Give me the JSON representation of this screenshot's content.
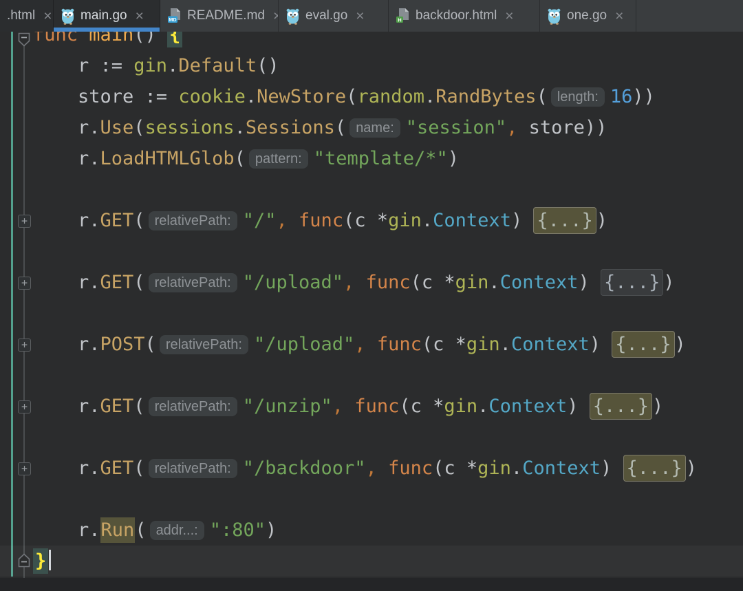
{
  "tab_bar": {
    "close_glyph": "×",
    "tabs": [
      {
        "label": ".html",
        "icon": null,
        "shade": "dark",
        "active": false
      },
      {
        "label": "main.go",
        "icon": "go-gopher-icon",
        "shade": "dark",
        "active": true
      },
      {
        "label": "README.md",
        "icon": "markdown-file-icon",
        "shade": "light",
        "active": false
      },
      {
        "label": "eval.go",
        "icon": "go-gopher-icon",
        "shade": "light",
        "active": false
      },
      {
        "label": "backdoor.html",
        "icon": "html-file-icon",
        "shade": "light",
        "active": false
      },
      {
        "label": "one.go",
        "icon": "go-gopher-icon",
        "shade": "light",
        "active": false
      }
    ]
  },
  "colors": {
    "editor_background": "#2B2C2D",
    "tab_bar_background": "#3A3D3F",
    "active_tab_underline": "#4385C9",
    "keyword": "#D4854A",
    "function_call": "#C8A465",
    "package_name": "#AFB556",
    "string": "#73A65B",
    "number": "#549FDA",
    "type_name": "#54A8C7",
    "matched_brace_text": "#FDEB3A",
    "matched_brace_background": "#3B514D",
    "fold_highlight_background": "#56543A",
    "vcs_change_stripe": "#53A08D",
    "go_file_icon_blue": "#7EC9E3",
    "markdown_badge_blue": "#369FD4",
    "html_badge_green": "#4F9C49"
  },
  "editor": {
    "language": "Go",
    "lines": [
      {
        "g": "fold-top",
        "ind": 0,
        "tk": [
          [
            "kw",
            "func "
          ],
          [
            "fndecl",
            "main"
          ],
          [
            "p",
            "() "
          ],
          [
            "brace",
            "{"
          ]
        ]
      },
      {
        "ind": 1,
        "tk": [
          [
            "p",
            "r := "
          ],
          [
            "pkg",
            "gin"
          ],
          [
            "p",
            "."
          ],
          [
            "fn",
            "Default"
          ],
          [
            "p",
            "()"
          ]
        ]
      },
      {
        "ind": 1,
        "tk": [
          [
            "p",
            "store := "
          ],
          [
            "pkg",
            "cookie"
          ],
          [
            "p",
            "."
          ],
          [
            "fn",
            "NewStore"
          ],
          [
            "p",
            "("
          ],
          [
            "pkg",
            "random"
          ],
          [
            "p",
            "."
          ],
          [
            "fn",
            "RandBytes"
          ],
          [
            "p",
            "("
          ],
          [
            "hint",
            "length:"
          ],
          [
            "num",
            "16"
          ],
          [
            "p",
            "))"
          ]
        ]
      },
      {
        "ind": 1,
        "tk": [
          [
            "p",
            "r."
          ],
          [
            "fn",
            "Use"
          ],
          [
            "p",
            "("
          ],
          [
            "pkg",
            "sessions"
          ],
          [
            "p",
            "."
          ],
          [
            "fn",
            "Sessions"
          ],
          [
            "p",
            "("
          ],
          [
            "hint",
            "name:"
          ],
          [
            "str",
            "\"session\""
          ],
          [
            "comma",
            ","
          ],
          [
            "p",
            " store))"
          ]
        ]
      },
      {
        "ind": 1,
        "tk": [
          [
            "p",
            "r."
          ],
          [
            "fn",
            "LoadHTMLGlob"
          ],
          [
            "p",
            "("
          ],
          [
            "hint",
            "pattern:"
          ],
          [
            "str",
            "\"template/*\""
          ],
          [
            "p",
            ")"
          ]
        ]
      },
      {
        "tk": []
      },
      {
        "g": "plus",
        "ind": 1,
        "tk": [
          [
            "p",
            "r."
          ],
          [
            "fn",
            "GET"
          ],
          [
            "p",
            "("
          ],
          [
            "hint",
            "relativePath:"
          ],
          [
            "str",
            "\"/\""
          ],
          [
            "comma",
            ","
          ],
          [
            "p",
            " "
          ],
          [
            "kw",
            "func"
          ],
          [
            "p",
            "(c *"
          ],
          [
            "pkg",
            "gin"
          ],
          [
            "p",
            "."
          ],
          [
            "typ",
            "Context"
          ],
          [
            "p",
            ") "
          ],
          [
            "foldhl",
            "{...}"
          ],
          [
            "p",
            ")"
          ]
        ]
      },
      {
        "tk": []
      },
      {
        "g": "plus",
        "ind": 1,
        "tk": [
          [
            "p",
            "r."
          ],
          [
            "fn",
            "GET"
          ],
          [
            "p",
            "("
          ],
          [
            "hint",
            "relativePath:"
          ],
          [
            "str",
            "\"/upload\""
          ],
          [
            "comma",
            ","
          ],
          [
            "p",
            " "
          ],
          [
            "kw",
            "func"
          ],
          [
            "p",
            "(c *"
          ],
          [
            "pkg",
            "gin"
          ],
          [
            "p",
            "."
          ],
          [
            "typ",
            "Context"
          ],
          [
            "p",
            ") "
          ],
          [
            "fold",
            "{...}"
          ],
          [
            "p",
            ")"
          ]
        ]
      },
      {
        "tk": []
      },
      {
        "g": "plus",
        "ind": 1,
        "tk": [
          [
            "p",
            "r."
          ],
          [
            "fn",
            "POST"
          ],
          [
            "p",
            "("
          ],
          [
            "hint",
            "relativePath:"
          ],
          [
            "str",
            "\"/upload\""
          ],
          [
            "comma",
            ","
          ],
          [
            "p",
            " "
          ],
          [
            "kw",
            "func"
          ],
          [
            "p",
            "(c *"
          ],
          [
            "pkg",
            "gin"
          ],
          [
            "p",
            "."
          ],
          [
            "typ",
            "Context"
          ],
          [
            "p",
            ") "
          ],
          [
            "foldhl",
            "{...}"
          ],
          [
            "p",
            ")"
          ]
        ]
      },
      {
        "tk": []
      },
      {
        "g": "plus",
        "ind": 1,
        "tk": [
          [
            "p",
            "r."
          ],
          [
            "fn",
            "GET"
          ],
          [
            "p",
            "("
          ],
          [
            "hint",
            "relativePath:"
          ],
          [
            "str",
            "\"/unzip\""
          ],
          [
            "comma",
            ","
          ],
          [
            "p",
            " "
          ],
          [
            "kw",
            "func"
          ],
          [
            "p",
            "(c *"
          ],
          [
            "pkg",
            "gin"
          ],
          [
            "p",
            "."
          ],
          [
            "typ",
            "Context"
          ],
          [
            "p",
            ") "
          ],
          [
            "foldhl",
            "{...}"
          ],
          [
            "p",
            ")"
          ]
        ]
      },
      {
        "tk": []
      },
      {
        "g": "plus",
        "ind": 1,
        "tk": [
          [
            "p",
            "r."
          ],
          [
            "fn",
            "GET"
          ],
          [
            "p",
            "("
          ],
          [
            "hint",
            "relativePath:"
          ],
          [
            "str",
            "\"/backdoor\""
          ],
          [
            "comma",
            ","
          ],
          [
            "p",
            " "
          ],
          [
            "kw",
            "func"
          ],
          [
            "p",
            "(c *"
          ],
          [
            "pkg",
            "gin"
          ],
          [
            "p",
            "."
          ],
          [
            "typ",
            "Context"
          ],
          [
            "p",
            ") "
          ],
          [
            "foldhl",
            "{...}"
          ],
          [
            "p",
            ")"
          ]
        ]
      },
      {
        "tk": []
      },
      {
        "ind": 1,
        "tk": [
          [
            "p",
            "r."
          ],
          [
            "fnhl",
            "Run"
          ],
          [
            "p",
            "("
          ],
          [
            "hint",
            "addr...:"
          ],
          [
            "str",
            "\":80\""
          ],
          [
            "p",
            ")"
          ]
        ]
      },
      {
        "g": "fold-bottom",
        "ind": 0,
        "caretLine": true,
        "tk": [
          [
            "brace",
            "}"
          ],
          [
            "caret",
            ""
          ]
        ]
      }
    ]
  }
}
